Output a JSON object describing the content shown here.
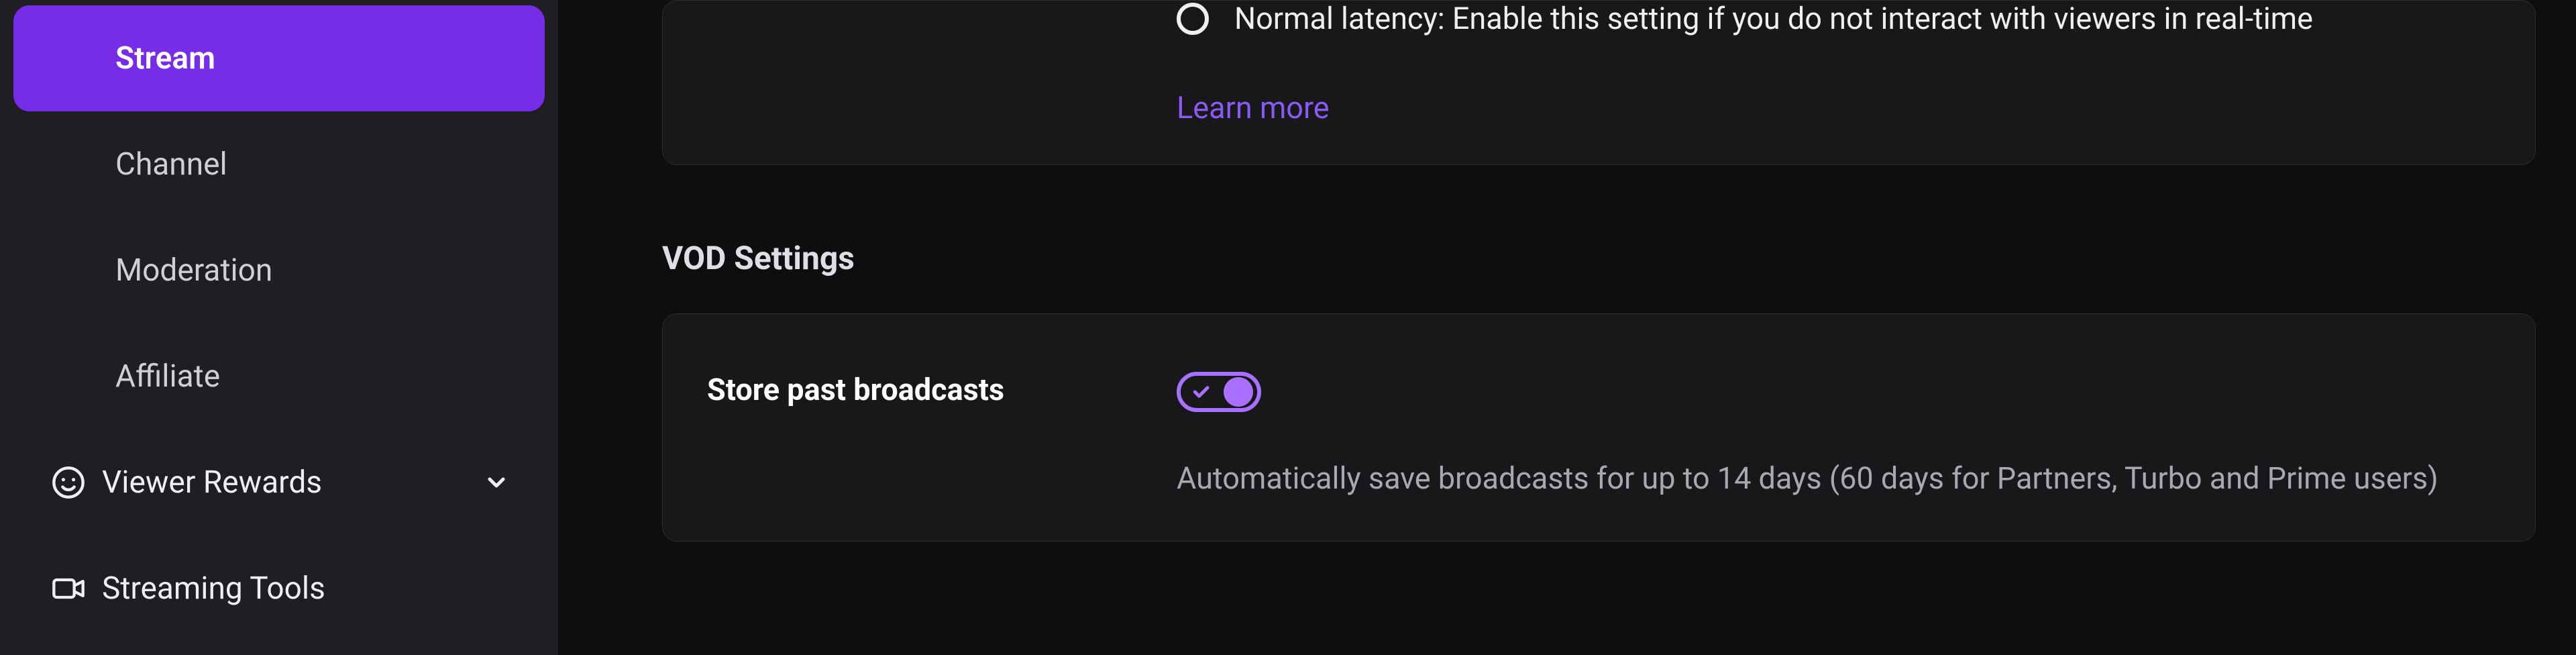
{
  "sidebar": {
    "items": [
      {
        "label": "Stream"
      },
      {
        "label": "Channel"
      },
      {
        "label": "Moderation"
      },
      {
        "label": "Affiliate"
      }
    ],
    "groups": [
      {
        "label": "Viewer Rewards"
      },
      {
        "label": "Streaming Tools"
      }
    ]
  },
  "latency": {
    "normal_label": "Normal latency: Enable this setting if you do not interact with viewers in real-time",
    "learn_more": "Learn more"
  },
  "vod": {
    "section_title": "VOD Settings",
    "store_label": "Store past broadcasts",
    "store_desc": "Automatically save broadcasts for up to 14 days (60 days for Partners, Turbo and Prime users)"
  }
}
